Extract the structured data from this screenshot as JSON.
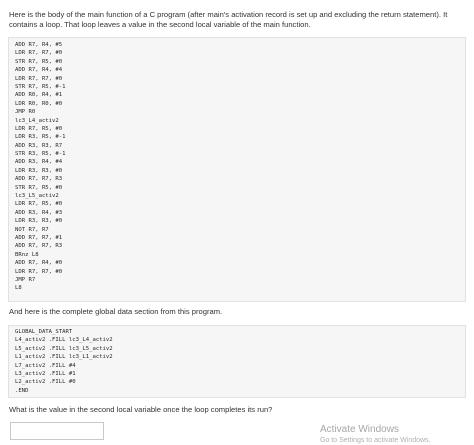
{
  "intro_text": "Here is the body of the main function of a C program (after main's activation record is set up and excluding the return statement). It contains a loop. That loop leaves a value in the second local variable of the main function.",
  "code_main": [
    "ADD R7, R4, #5",
    "LDR R7, R7, #0",
    "STR R7, R5, #0",
    "ADD R7, R4, #4",
    "LDR R7, R7, #0",
    "STR R7, R5, #-1",
    "ADD R0, R4, #1",
    "LDR R0, R0, #0",
    "JMP R0",
    "lc3_L4_activ2",
    "LDR R7, R5, #0",
    "LDR R3, R5, #-1",
    "ADD R3, R3, R7",
    "STR R3, R5, #-1",
    "ADD R3, R4, #4",
    "LDR R3, R3, #0",
    "ADD R7, R7, R3",
    "STR R7, R5, #0",
    "lc3_L5_activ2",
    "LDR R7, R5, #0",
    "ADD R3, R4, #3",
    "LDR R3, R3, #0",
    "NOT R7, R7",
    "ADD R7, R7, #1",
    "ADD R7, R7, R3",
    "BRnz L8",
    "ADD R7, R4, #0",
    "LDR R7, R7, #0",
    "JMP R7",
    "L8"
  ],
  "mid_text": "And here is the complete global data section from this program.",
  "code_data": [
    "GLOBAL_DATA_START",
    "L4_activ2 .FILL lc3_L4_activ2",
    "L5_activ2 .FILL lc3_L5_activ2",
    "L1_activ2 .FILL lc3_L1_activ2",
    "L7_activ2 .FILL #4",
    "L3_activ2 .FILL #1",
    "L2_activ2 .FILL #0",
    ".END"
  ],
  "question_text": "What is the value in the second local variable once the loop completes its run?",
  "answer_value": "",
  "watermark": {
    "title": "Activate Windows",
    "subtitle": "Go to Settings to activate Windows."
  }
}
